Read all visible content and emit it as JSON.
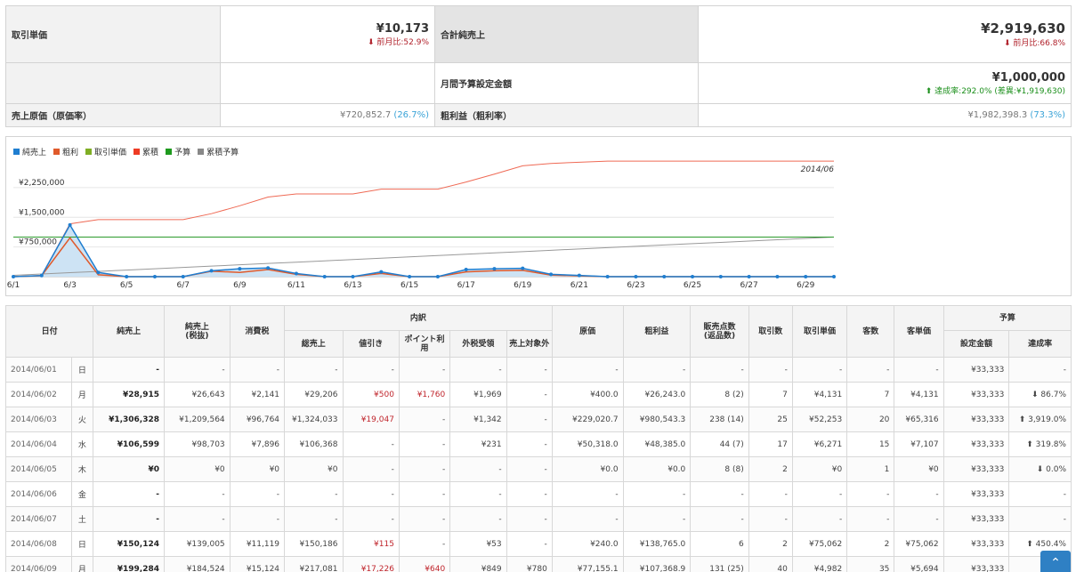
{
  "summary": {
    "avg_label": "取引単価",
    "avg_value": "¥10,173",
    "avg_change": "前月比:52.9%",
    "net_label": "合計純売上",
    "net_value": "¥2,919,630",
    "net_change": "前月比:66.8%",
    "budget_label": "月間予算設定金額",
    "budget_value": "¥1,000,000",
    "budget_rate": "達成率:292.0%",
    "budget_diff": "(差異:¥1,919,630)",
    "cost_label": "売上原価（原価率）",
    "cost_value": "¥720,852.7",
    "cost_pct": "(26.7%)",
    "profit_label": "粗利益（粗利率）",
    "profit_value": "¥1,982,398.3",
    "profit_pct": "(73.3%)"
  },
  "chart_data": {
    "type": "line",
    "annotation": "2014/06",
    "legend": [
      {
        "name": "純売上",
        "color": "#1f7ed0"
      },
      {
        "name": "粗利",
        "color": "#e05a2b"
      },
      {
        "name": "取引単価",
        "color": "#7fae24"
      },
      {
        "name": "累積",
        "color": "#ee3b24"
      },
      {
        "name": "予算",
        "color": "#1e9a1e"
      },
      {
        "name": "累積予算",
        "color": "#888888"
      }
    ],
    "y_ticks": [
      "¥750,000",
      "¥1,500,000",
      "¥2,250,000"
    ],
    "x_ticks": [
      "6/1",
      "6/3",
      "6/5",
      "6/7",
      "6/9",
      "6/11",
      "6/13",
      "6/15",
      "6/17",
      "6/19",
      "6/21",
      "6/23",
      "6/25",
      "6/27",
      "6/29"
    ],
    "ylim": [
      0,
      2900000
    ],
    "series": [
      {
        "name": "純売上",
        "values": [
          0,
          28915,
          1306328,
          106599,
          0,
          0,
          0,
          150124,
          199284,
          220000,
          80000,
          0,
          0,
          120000,
          0,
          0,
          180000,
          200000,
          210000,
          60000,
          30000,
          0,
          0,
          0,
          0,
          0,
          0,
          0,
          0,
          0
        ]
      },
      {
        "name": "粗利",
        "values": [
          0,
          26243,
          980543,
          48385,
          0,
          0,
          0,
          138765,
          107369,
          180000,
          60000,
          0,
          0,
          80000,
          0,
          0,
          120000,
          150000,
          160000,
          40000,
          20000,
          0,
          0,
          0,
          0,
          0,
          0,
          0,
          0,
          0
        ]
      },
      {
        "name": "累積",
        "values": [
          0,
          28915,
          1335243,
          1441842,
          1441842,
          1441842,
          1441842,
          1591966,
          1791250,
          2011250,
          2091250,
          2091250,
          2091250,
          2211250,
          2211250,
          2211250,
          2391250,
          2591250,
          2801250,
          2861250,
          2891250,
          2919630,
          2919630,
          2919630,
          2919630,
          2919630,
          2919630,
          2919630,
          2919630,
          2919630
        ]
      },
      {
        "name": "予算",
        "values": [
          1000000,
          1000000,
          1000000,
          1000000,
          1000000,
          1000000,
          1000000,
          1000000,
          1000000,
          1000000,
          1000000,
          1000000,
          1000000,
          1000000,
          1000000,
          1000000,
          1000000,
          1000000,
          1000000,
          1000000,
          1000000,
          1000000,
          1000000,
          1000000,
          1000000,
          1000000,
          1000000,
          1000000,
          1000000,
          1000000
        ]
      },
      {
        "name": "累積予算",
        "values": [
          33333,
          66666,
          99999,
          133332,
          166665,
          199998,
          233331,
          266664,
          299997,
          333330,
          366663,
          399996,
          433329,
          466662,
          499995,
          533328,
          566661,
          599994,
          633327,
          666660,
          699993,
          733326,
          766659,
          799992,
          833325,
          866658,
          899991,
          933324,
          966657,
          1000000
        ]
      }
    ]
  },
  "table": {
    "headers": {
      "date": "日付",
      "net": "純売上",
      "net_ex": "純売上\n(税抜)",
      "tax": "消費税",
      "breakdown": "内訳",
      "gross": "総売上",
      "discount": "値引き",
      "point": "ポイント利用",
      "ext_tax": "外税受領",
      "non_target": "売上対象外",
      "cost": "原価",
      "profit": "粗利益",
      "qty": "販売点数\n(返品数)",
      "txn": "取引数",
      "avg": "取引単価",
      "customers": "客数",
      "cust_avg": "客単価",
      "budget": "予算",
      "budget_amt": "設定金額",
      "rate": "達成率"
    },
    "rows": [
      {
        "date": "2014/06/01",
        "dow": "日",
        "net": "-",
        "net_ex": "-",
        "tax": "-",
        "gross": "-",
        "discount": "-",
        "point": "-",
        "ext_tax": "-",
        "non_target": "-",
        "cost": "-",
        "profit": "-",
        "qty": "-",
        "txn": "-",
        "avg": "-",
        "customers": "-",
        "cust_avg": "-",
        "budget_amt": "¥33,333",
        "rate": "-"
      },
      {
        "date": "2014/06/02",
        "dow": "月",
        "net": "¥28,915",
        "net_ex": "¥26,643",
        "tax": "¥2,141",
        "gross": "¥29,206",
        "discount": "¥500",
        "point": "¥1,760",
        "ext_tax": "¥1,969",
        "non_target": "-",
        "cost": "¥400.0",
        "profit": "¥26,243.0",
        "qty": "8 (2)",
        "txn": "7",
        "avg": "¥4,131",
        "customers": "7",
        "cust_avg": "¥4,131",
        "budget_amt": "¥33,333",
        "rate": "86.7%"
      },
      {
        "date": "2014/06/03",
        "dow": "火",
        "net": "¥1,306,328",
        "net_ex": "¥1,209,564",
        "tax": "¥96,764",
        "gross": "¥1,324,033",
        "discount": "¥19,047",
        "point": "-",
        "ext_tax": "¥1,342",
        "non_target": "-",
        "cost": "¥229,020.7",
        "profit": "¥980,543.3",
        "qty": "238 (14)",
        "txn": "25",
        "avg": "¥52,253",
        "customers": "20",
        "cust_avg": "¥65,316",
        "budget_amt": "¥33,333",
        "rate": "3,919.0%"
      },
      {
        "date": "2014/06/04",
        "dow": "水",
        "net": "¥106,599",
        "net_ex": "¥98,703",
        "tax": "¥7,896",
        "gross": "¥106,368",
        "discount": "-",
        "point": "-",
        "ext_tax": "¥231",
        "non_target": "-",
        "cost": "¥50,318.0",
        "profit": "¥48,385.0",
        "qty": "44 (7)",
        "txn": "17",
        "avg": "¥6,271",
        "customers": "15",
        "cust_avg": "¥7,107",
        "budget_amt": "¥33,333",
        "rate": "319.8%"
      },
      {
        "date": "2014/06/05",
        "dow": "木",
        "net": "¥0",
        "net_ex": "¥0",
        "tax": "¥0",
        "gross": "¥0",
        "discount": "-",
        "point": "-",
        "ext_tax": "-",
        "non_target": "-",
        "cost": "¥0.0",
        "profit": "¥0.0",
        "qty": "8 (8)",
        "txn": "2",
        "avg": "¥0",
        "customers": "1",
        "cust_avg": "¥0",
        "budget_amt": "¥33,333",
        "rate": "0.0%"
      },
      {
        "date": "2014/06/06",
        "dow": "金",
        "net": "-",
        "net_ex": "-",
        "tax": "-",
        "gross": "-",
        "discount": "-",
        "point": "-",
        "ext_tax": "-",
        "non_target": "-",
        "cost": "-",
        "profit": "-",
        "qty": "-",
        "txn": "-",
        "avg": "-",
        "customers": "-",
        "cust_avg": "-",
        "budget_amt": "¥33,333",
        "rate": "-"
      },
      {
        "date": "2014/06/07",
        "dow": "土",
        "net": "-",
        "net_ex": "-",
        "tax": "-",
        "gross": "-",
        "discount": "-",
        "point": "-",
        "ext_tax": "-",
        "non_target": "-",
        "cost": "-",
        "profit": "-",
        "qty": "-",
        "txn": "-",
        "avg": "-",
        "customers": "-",
        "cust_avg": "-",
        "budget_amt": "¥33,333",
        "rate": "-"
      },
      {
        "date": "2014/06/08",
        "dow": "日",
        "net": "¥150,124",
        "net_ex": "¥139,005",
        "tax": "¥11,119",
        "gross": "¥150,186",
        "discount": "¥115",
        "point": "-",
        "ext_tax": "¥53",
        "non_target": "-",
        "cost": "¥240.0",
        "profit": "¥138,765.0",
        "qty": "6",
        "txn": "2",
        "avg": "¥75,062",
        "customers": "2",
        "cust_avg": "¥75,062",
        "budget_amt": "¥33,333",
        "rate": "450.4%"
      },
      {
        "date": "2014/06/09",
        "dow": "月",
        "net": "¥199,284",
        "net_ex": "¥184,524",
        "tax": "¥15,124",
        "gross": "¥217,081",
        "discount": "¥17,226",
        "point": "¥640",
        "ext_tax": "¥849",
        "non_target": "¥780",
        "cost": "¥77,155.1",
        "profit": "¥107,368.9",
        "qty": "131 (25)",
        "txn": "40",
        "avg": "¥4,982",
        "customers": "35",
        "cust_avg": "¥5,694",
        "budget_amt": "¥33,333",
        "rate": "59"
      }
    ],
    "rate_dirs": [
      "",
      "down",
      "up",
      "up",
      "down",
      "",
      "",
      "up",
      "up"
    ]
  },
  "icons": {
    "down": "arrow-down-icon",
    "up": "arrow-up-icon",
    "top": "chevron-up-icon"
  }
}
